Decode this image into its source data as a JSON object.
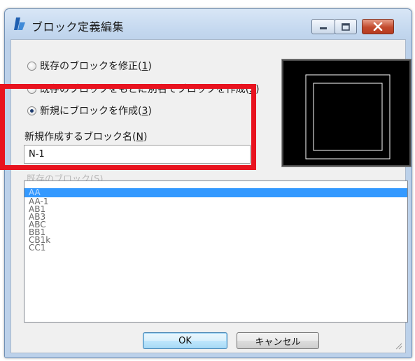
{
  "window": {
    "title": "ブロック定義編集",
    "app_icon": "bricscad-logo-icon",
    "controls": [
      "minimize-icon",
      "maximize-icon",
      "close-icon"
    ]
  },
  "options": [
    {
      "label": "既存のブロックを修正(",
      "key": "1",
      "suffix": ")",
      "checked": false
    },
    {
      "label": "既存のブロックをもとに別名でブロックを作成(",
      "key": "2",
      "suffix": ")",
      "checked": false
    },
    {
      "label": "新規にブロックを作成(",
      "key": "3",
      "suffix": ")",
      "checked": true
    }
  ],
  "name_field": {
    "label": "新規作成するブロック名(",
    "key": "N",
    "label_suffix": ")",
    "value": "N-1"
  },
  "existing_blocks": {
    "label": "既存のブロック(S)",
    "items": [
      "AA",
      "AA-1",
      "AB1",
      "AB3",
      "ABC",
      "BB1",
      "CB1k",
      "CC1"
    ],
    "selected_index": 0
  },
  "buttons": {
    "ok": "OK",
    "cancel": "キャンセル"
  },
  "colors": {
    "highlight": "#e8131f",
    "selection": "#3399ff",
    "preview_background": "#000000"
  }
}
